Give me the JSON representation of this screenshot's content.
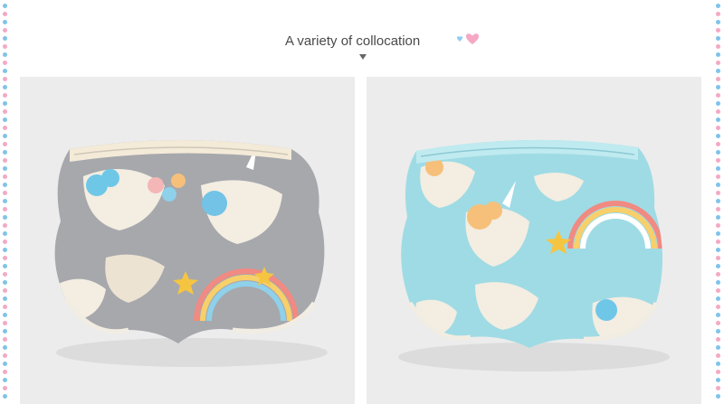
{
  "header": {
    "title": "A variety of collocation",
    "heart_icons": [
      "small-blue-heart-icon",
      "pink-heart-icon"
    ],
    "arrow_icon": "chevron-down-icon"
  },
  "border": {
    "dot_colors": [
      "#7fc3ea",
      "#f3a9c4"
    ]
  },
  "photos": [
    {
      "name": "grey-unicorn-bloomers",
      "fabric_color": "#a6a8ac",
      "print": "unicorn-rainbow-balloon"
    },
    {
      "name": "aqua-unicorn-bloomers",
      "fabric_color": "#9fdbe4",
      "print": "unicorn-rainbow-star"
    }
  ],
  "colors": {
    "background": "#ffffff",
    "photo_backdrop": "#ececec",
    "title_text": "#4a4a4a"
  }
}
